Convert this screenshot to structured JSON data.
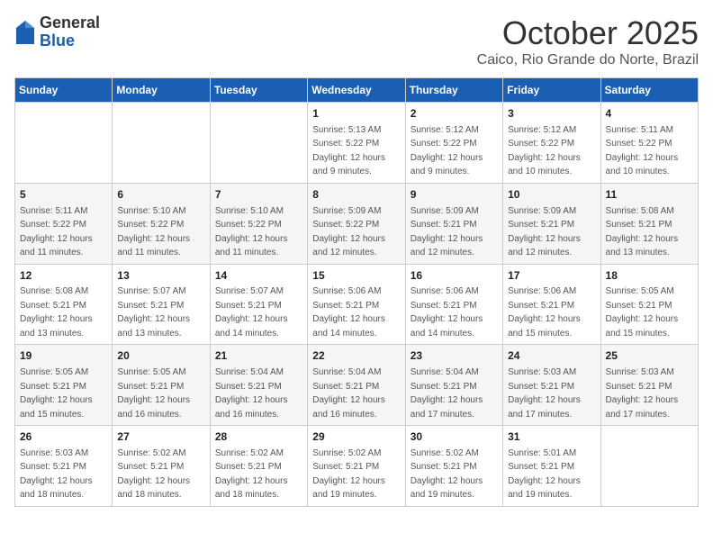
{
  "header": {
    "logo_general": "General",
    "logo_blue": "Blue",
    "month_title": "October 2025",
    "location": "Caico, Rio Grande do Norte, Brazil"
  },
  "days_of_week": [
    "Sunday",
    "Monday",
    "Tuesday",
    "Wednesday",
    "Thursday",
    "Friday",
    "Saturday"
  ],
  "weeks": [
    [
      {
        "day": "",
        "info": ""
      },
      {
        "day": "",
        "info": ""
      },
      {
        "day": "",
        "info": ""
      },
      {
        "day": "1",
        "info": "Sunrise: 5:13 AM\nSunset: 5:22 PM\nDaylight: 12 hours and 9 minutes."
      },
      {
        "day": "2",
        "info": "Sunrise: 5:12 AM\nSunset: 5:22 PM\nDaylight: 12 hours and 9 minutes."
      },
      {
        "day": "3",
        "info": "Sunrise: 5:12 AM\nSunset: 5:22 PM\nDaylight: 12 hours and 10 minutes."
      },
      {
        "day": "4",
        "info": "Sunrise: 5:11 AM\nSunset: 5:22 PM\nDaylight: 12 hours and 10 minutes."
      }
    ],
    [
      {
        "day": "5",
        "info": "Sunrise: 5:11 AM\nSunset: 5:22 PM\nDaylight: 12 hours and 11 minutes."
      },
      {
        "day": "6",
        "info": "Sunrise: 5:10 AM\nSunset: 5:22 PM\nDaylight: 12 hours and 11 minutes."
      },
      {
        "day": "7",
        "info": "Sunrise: 5:10 AM\nSunset: 5:22 PM\nDaylight: 12 hours and 11 minutes."
      },
      {
        "day": "8",
        "info": "Sunrise: 5:09 AM\nSunset: 5:22 PM\nDaylight: 12 hours and 12 minutes."
      },
      {
        "day": "9",
        "info": "Sunrise: 5:09 AM\nSunset: 5:21 PM\nDaylight: 12 hours and 12 minutes."
      },
      {
        "day": "10",
        "info": "Sunrise: 5:09 AM\nSunset: 5:21 PM\nDaylight: 12 hours and 12 minutes."
      },
      {
        "day": "11",
        "info": "Sunrise: 5:08 AM\nSunset: 5:21 PM\nDaylight: 12 hours and 13 minutes."
      }
    ],
    [
      {
        "day": "12",
        "info": "Sunrise: 5:08 AM\nSunset: 5:21 PM\nDaylight: 12 hours and 13 minutes."
      },
      {
        "day": "13",
        "info": "Sunrise: 5:07 AM\nSunset: 5:21 PM\nDaylight: 12 hours and 13 minutes."
      },
      {
        "day": "14",
        "info": "Sunrise: 5:07 AM\nSunset: 5:21 PM\nDaylight: 12 hours and 14 minutes."
      },
      {
        "day": "15",
        "info": "Sunrise: 5:06 AM\nSunset: 5:21 PM\nDaylight: 12 hours and 14 minutes."
      },
      {
        "day": "16",
        "info": "Sunrise: 5:06 AM\nSunset: 5:21 PM\nDaylight: 12 hours and 14 minutes."
      },
      {
        "day": "17",
        "info": "Sunrise: 5:06 AM\nSunset: 5:21 PM\nDaylight: 12 hours and 15 minutes."
      },
      {
        "day": "18",
        "info": "Sunrise: 5:05 AM\nSunset: 5:21 PM\nDaylight: 12 hours and 15 minutes."
      }
    ],
    [
      {
        "day": "19",
        "info": "Sunrise: 5:05 AM\nSunset: 5:21 PM\nDaylight: 12 hours and 15 minutes."
      },
      {
        "day": "20",
        "info": "Sunrise: 5:05 AM\nSunset: 5:21 PM\nDaylight: 12 hours and 16 minutes."
      },
      {
        "day": "21",
        "info": "Sunrise: 5:04 AM\nSunset: 5:21 PM\nDaylight: 12 hours and 16 minutes."
      },
      {
        "day": "22",
        "info": "Sunrise: 5:04 AM\nSunset: 5:21 PM\nDaylight: 12 hours and 16 minutes."
      },
      {
        "day": "23",
        "info": "Sunrise: 5:04 AM\nSunset: 5:21 PM\nDaylight: 12 hours and 17 minutes."
      },
      {
        "day": "24",
        "info": "Sunrise: 5:03 AM\nSunset: 5:21 PM\nDaylight: 12 hours and 17 minutes."
      },
      {
        "day": "25",
        "info": "Sunrise: 5:03 AM\nSunset: 5:21 PM\nDaylight: 12 hours and 17 minutes."
      }
    ],
    [
      {
        "day": "26",
        "info": "Sunrise: 5:03 AM\nSunset: 5:21 PM\nDaylight: 12 hours and 18 minutes."
      },
      {
        "day": "27",
        "info": "Sunrise: 5:02 AM\nSunset: 5:21 PM\nDaylight: 12 hours and 18 minutes."
      },
      {
        "day": "28",
        "info": "Sunrise: 5:02 AM\nSunset: 5:21 PM\nDaylight: 12 hours and 18 minutes."
      },
      {
        "day": "29",
        "info": "Sunrise: 5:02 AM\nSunset: 5:21 PM\nDaylight: 12 hours and 19 minutes."
      },
      {
        "day": "30",
        "info": "Sunrise: 5:02 AM\nSunset: 5:21 PM\nDaylight: 12 hours and 19 minutes."
      },
      {
        "day": "31",
        "info": "Sunrise: 5:01 AM\nSunset: 5:21 PM\nDaylight: 12 hours and 19 minutes."
      },
      {
        "day": "",
        "info": ""
      }
    ]
  ]
}
